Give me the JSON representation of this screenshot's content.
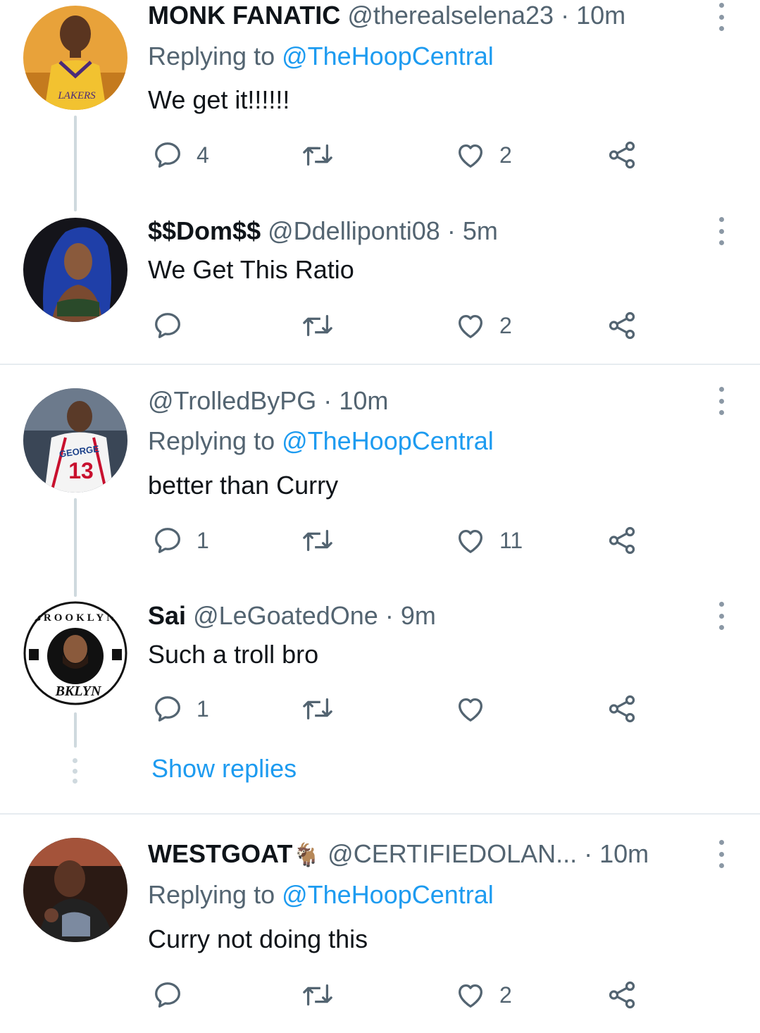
{
  "tweets": [
    {
      "name": "MONK FANATIC",
      "handle": "@therealselena23",
      "separator": "·",
      "time": "10m",
      "replying_prefix": "Replying to ",
      "replying_mention": "@TheHoopCentral",
      "text": "We get it!!!!!!",
      "reply_count": "4",
      "retweet_count": "",
      "like_count": "2"
    },
    {
      "name": "$$Dom$$",
      "handle": "@Ddelliponti08",
      "separator": "·",
      "time": "5m",
      "text": "We Get This Ratio",
      "reply_count": "",
      "retweet_count": "",
      "like_count": "2"
    },
    {
      "name": "",
      "handle": "@TrolledByPG",
      "separator": "·",
      "time": "10m",
      "replying_prefix": "Replying to ",
      "replying_mention": "@TheHoopCentral",
      "text": "better than Curry",
      "reply_count": "1",
      "retweet_count": "",
      "like_count": "11"
    },
    {
      "name": "Sai",
      "handle": "@LeGoatedOne",
      "separator": "·",
      "time": "9m",
      "text": "Such a troll bro",
      "reply_count": "1",
      "retweet_count": "",
      "like_count": ""
    },
    {
      "name": "WESTGOAT",
      "name_emoji": "🐐",
      "handle": "@CERTIFIEDOLAN...",
      "separator": "·",
      "time": "10m",
      "replying_prefix": "Replying to ",
      "replying_mention": "@TheHoopCentral",
      "text": "Curry not doing this",
      "reply_count": "",
      "retweet_count": "",
      "like_count": "2"
    }
  ],
  "show_replies_label": "Show replies",
  "avatar_labels": {
    "lakers": "LAKERS",
    "george": "GEORGE",
    "george_number": "13",
    "brooklyn": "BROOKLYN",
    "bklyn": "BKLYN"
  },
  "colors": {
    "link": "#1d9bf0",
    "secondary_text": "#536471",
    "thread_line": "#cfd9de",
    "divider": "#e6ecf0"
  }
}
